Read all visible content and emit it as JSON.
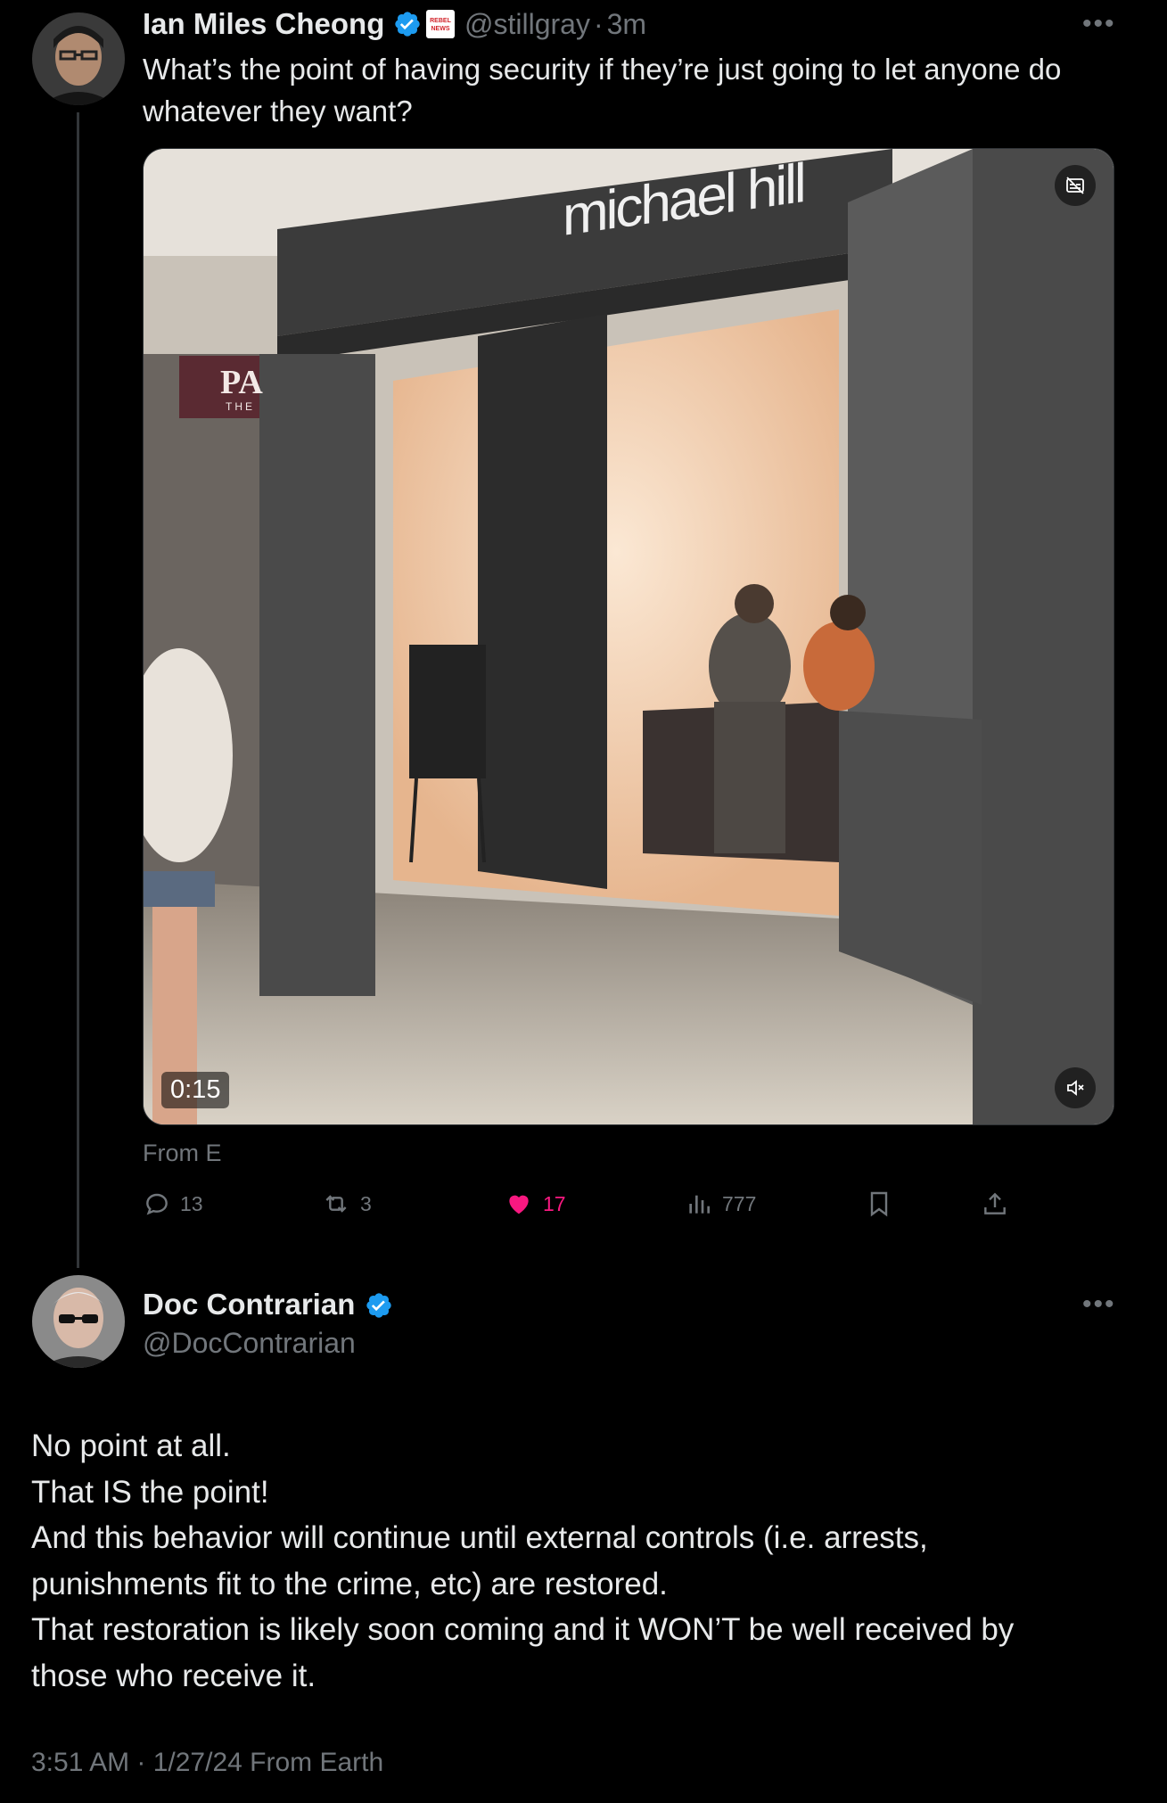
{
  "original_tweet": {
    "author_name": "Ian Miles Cheong",
    "handle": "@stillgray",
    "time_separator": "·",
    "time_ago": "3m",
    "affiliate_badge_text": "REBEL NEWS",
    "text": "What’s the point of having security if they’re just going to let anyone do whatever they want?",
    "media": {
      "type": "video",
      "duration": "0:15",
      "store_sign": "michael hill",
      "mall_sign": "PA",
      "mall_sign_sub": "THE"
    },
    "source": "From E",
    "actions": {
      "replies": "13",
      "reposts": "3",
      "likes": "17",
      "views": "777"
    },
    "icons": [
      "comment-icon",
      "repost-icon",
      "heart-icon",
      "views-icon",
      "bookmark-icon",
      "share-icon",
      "verified-icon",
      "mute-icon",
      "captions-icon",
      "more-icon"
    ]
  },
  "reply": {
    "author_name": "Doc Contrarian",
    "handle": "@DocContrarian",
    "lines": [
      "No point at all.",
      "That IS the point!",
      "And this behavior will continue until external controls (i.e. arrests,",
      "punishments fit to the crime, etc) are restored.",
      "That restoration is likely soon coming and it WON’T be well received by",
      "those who receive it."
    ],
    "timestamp": "3:51 AM · 1/27/24 From Earth"
  },
  "colors": {
    "background": "#000000",
    "text": "#e7e9ea",
    "muted": "#71767b",
    "verified": "#1d9bf0",
    "like": "#f91880"
  }
}
